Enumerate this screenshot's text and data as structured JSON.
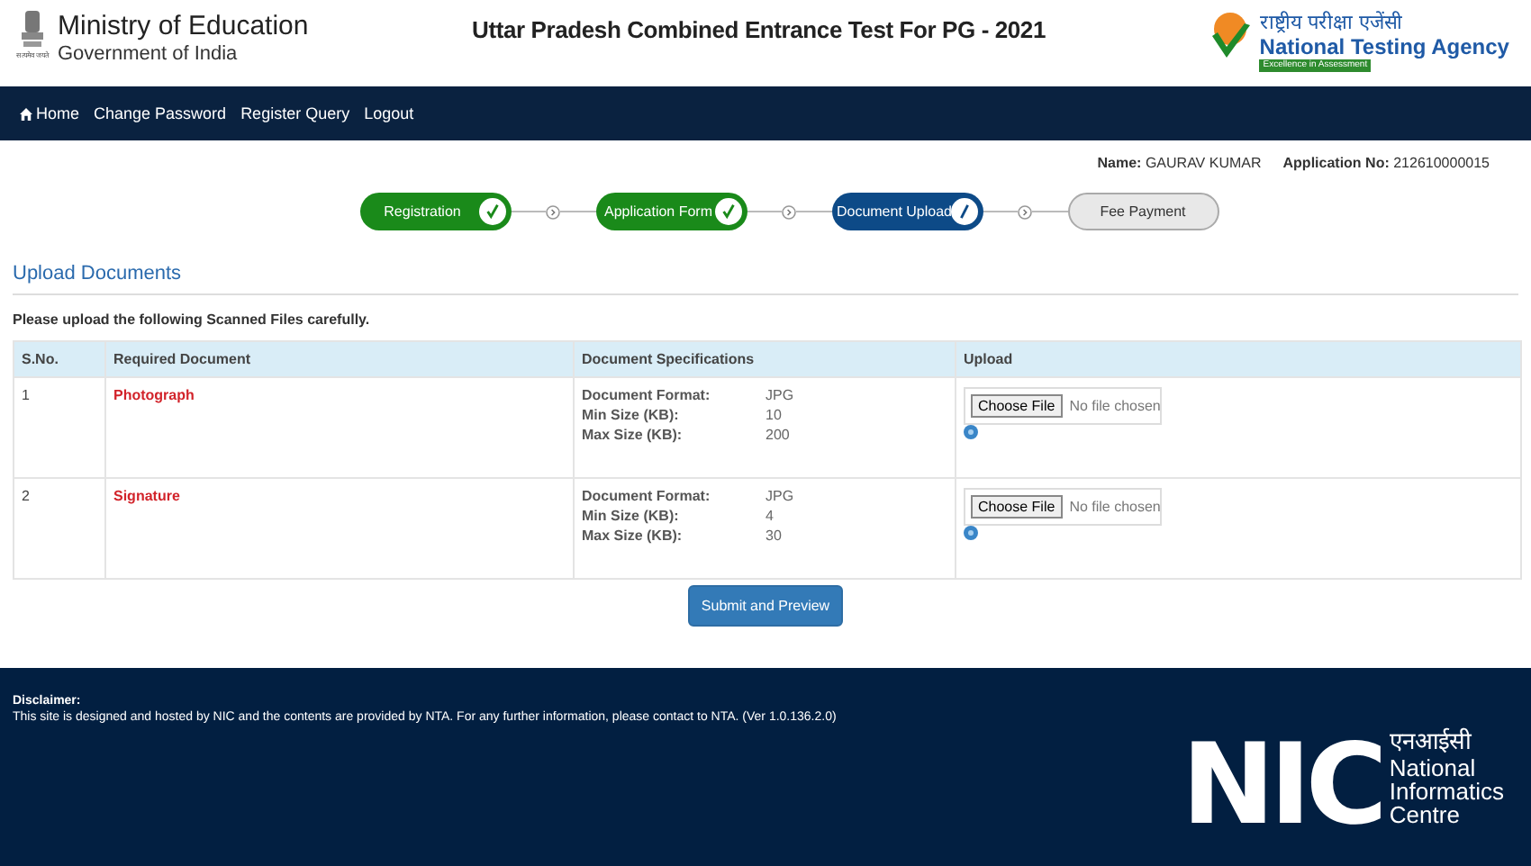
{
  "header": {
    "ministry": "Ministry of Education",
    "government": "Government of India",
    "emblem_caption": "सत्यमेव जयते",
    "title": "Uttar Pradesh Combined Entrance Test For PG - 2021",
    "agency_hindi": "राष्ट्रीय परीक्षा एजेंसी",
    "agency": "National Testing Agency",
    "agency_tagline": "Excellence in Assessment"
  },
  "nav": [
    {
      "label": "Home",
      "kind": "home"
    },
    {
      "label": "Change Password",
      "kind": "link"
    },
    {
      "label": "Register Query",
      "kind": "link"
    },
    {
      "label": "Logout",
      "kind": "link"
    }
  ],
  "candidate": {
    "name_label": "Name:",
    "name": "GAURAV KUMAR",
    "app_label": "Application No:",
    "app_no": "212610000015"
  },
  "steps": [
    {
      "label": "Registration",
      "completed": true,
      "selected": false
    },
    {
      "label": "Application Form",
      "completed": true,
      "selected": false
    },
    {
      "label": "Document Upload",
      "completed": false,
      "selected": true
    },
    {
      "label": "Fee Payment",
      "completed": false,
      "selected": false
    }
  ],
  "section_title": "Upload Documents",
  "instruction": "Please upload the following Scanned Files carefully.",
  "table": {
    "columns": [
      "S.No.",
      "Required Document",
      "Document Specifications",
      "Upload"
    ],
    "rows": [
      {
        "sno": "1",
        "document": "Photograph",
        "specs": [
          [
            "Document Format:",
            "JPG"
          ],
          [
            "Min Size (KB):",
            "10"
          ],
          [
            "Max Size (KB):",
            "200"
          ]
        ],
        "button": "Choose File",
        "file": "No file chosen"
      },
      {
        "sno": "2",
        "document": "Signature",
        "specs": [
          [
            "Document Format:",
            "JPG"
          ],
          [
            "Min Size (KB):",
            "4"
          ],
          [
            "Max Size (KB):",
            "30"
          ]
        ],
        "button": "Choose File",
        "file": "No file chosen"
      }
    ]
  },
  "submit": "Submit and Preview",
  "footer": {
    "disclaimer_title": "Disclaimer:",
    "disclaimer": "This site is designed and hosted by NIC and the contents are provided by NTA. For any further information, please contact to NTA. (Ver 1.0.136.2.0)",
    "nic": "NIC",
    "nic_hindi": "एनआईसी",
    "nic_lines": [
      "National",
      "Informatics",
      "Centre"
    ]
  }
}
